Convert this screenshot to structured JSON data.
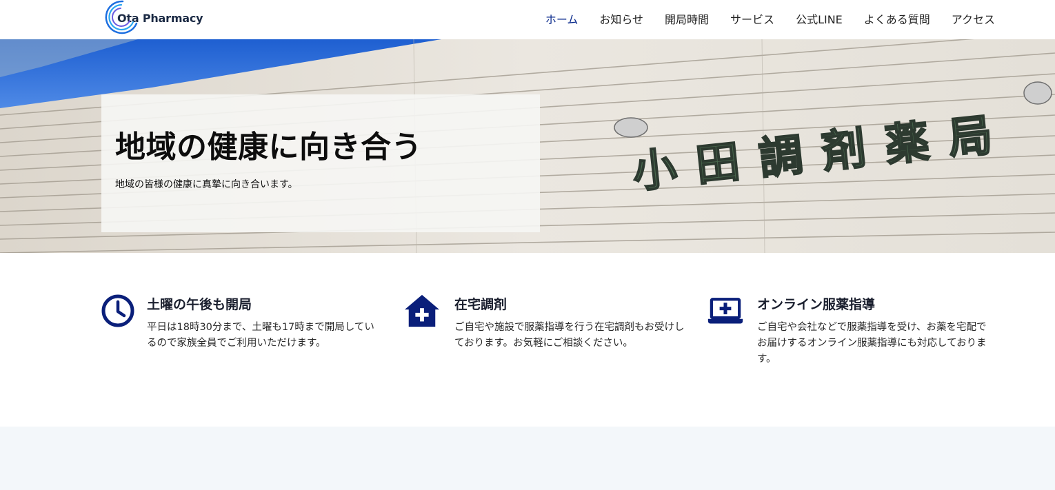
{
  "header": {
    "logo_text": "Ota Pharmacy",
    "nav": [
      {
        "label": "ホーム",
        "active": true
      },
      {
        "label": "お知らせ"
      },
      {
        "label": "開局時間"
      },
      {
        "label": "サービス"
      },
      {
        "label": "公式LINE"
      },
      {
        "label": "よくある質問"
      },
      {
        "label": "アクセス"
      }
    ]
  },
  "hero": {
    "title": "地域の健康に向き合う",
    "subtitle": "地域の皆様の健康に真摯に向き合います。",
    "sign_text": "小田調剤薬局"
  },
  "features": [
    {
      "icon": "clock-icon",
      "title": "土曜の午後も開局",
      "body": "平日は18時30分まで、土曜も17時まで開局しているので家族全員でご利用いただけます。"
    },
    {
      "icon": "home-medical-icon",
      "title": "在宅調剤",
      "body": "ご自宅や施設で服薬指導を行う在宅調剤もお受けしております。お気軽にご相談ください。"
    },
    {
      "icon": "laptop-medical-icon",
      "title": "オンライン服薬指導",
      "body": "ご自宅や会社などで服薬指導を受け、お薬を宅配でお届けするオンライン服薬指導にも対応しております。"
    }
  ],
  "colors": {
    "accent": "#0a1f7a",
    "nav_active": "#0a2a8c",
    "lower_bg": "#f3f7fa"
  }
}
